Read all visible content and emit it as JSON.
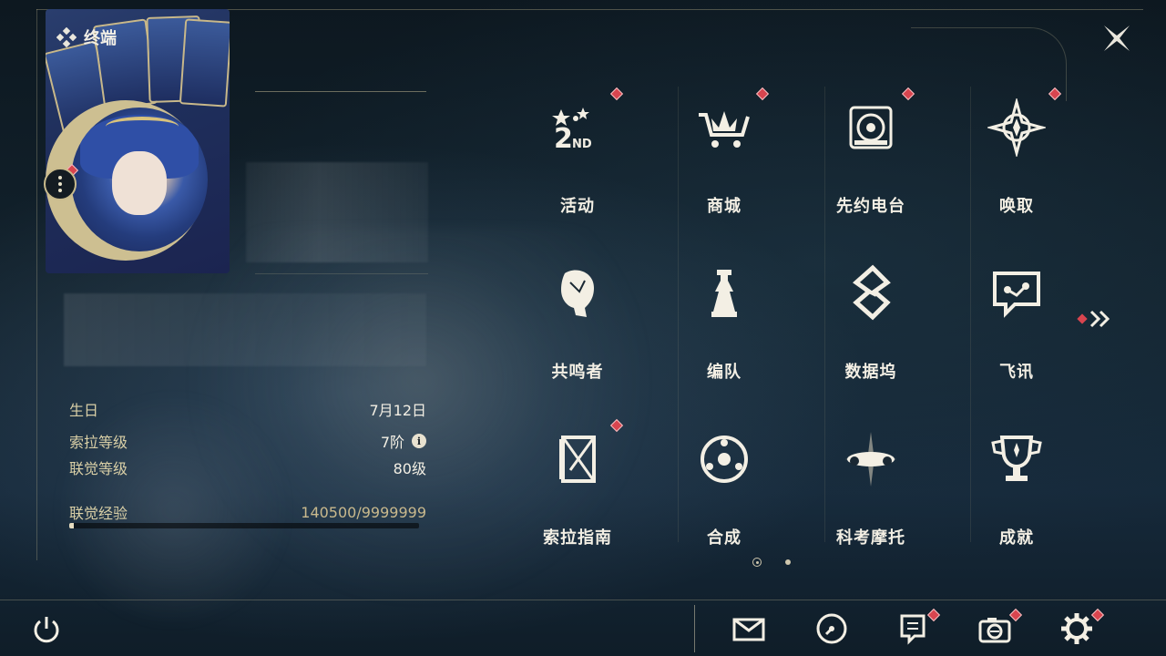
{
  "title": "终端",
  "profile": {
    "stats": [
      {
        "label": "生日",
        "value": "7月12日"
      },
      {
        "label": "索拉等级",
        "value": "7阶",
        "info_icon": "info-icon"
      },
      {
        "label": "联觉等级",
        "value": "80级"
      }
    ],
    "exp": {
      "label": "联觉经验",
      "value": "140500/9999999",
      "progress": 0.014
    }
  },
  "menu": [
    {
      "label": "活动",
      "icon": "2nd-anniversary-icon",
      "badge": true
    },
    {
      "label": "商城",
      "icon": "shopping-cart-icon",
      "badge": true
    },
    {
      "label": "先约电台",
      "icon": "radio-icon",
      "badge": true
    },
    {
      "label": "唤取",
      "icon": "convene-star-icon",
      "badge": true
    },
    {
      "label": "共鸣者",
      "icon": "resonator-head-icon",
      "badge": false
    },
    {
      "label": "编队",
      "icon": "team-chess-icon",
      "badge": false
    },
    {
      "label": "数据坞",
      "icon": "data-bank-icon",
      "badge": false
    },
    {
      "label": "飞讯",
      "icon": "chat-bubble-icon",
      "badge": false
    },
    {
      "label": "索拉指南",
      "icon": "guidebook-icon",
      "badge": true
    },
    {
      "label": "合成",
      "icon": "synthesis-icon",
      "badge": false
    },
    {
      "label": "科考摩托",
      "icon": "motorcycle-icon",
      "badge": false
    },
    {
      "label": "成就",
      "icon": "trophy-icon",
      "badge": false
    }
  ],
  "pagination": {
    "current": 1,
    "total": 2
  },
  "bottom_bar": {
    "items": [
      "mail-icon",
      "clock-icon",
      "notice-icon",
      "camera-icon",
      "settings-gear-icon"
    ]
  },
  "colors": {
    "accent": "#cdbf91",
    "badge": "#d8454f",
    "text": "#f3efe4"
  }
}
